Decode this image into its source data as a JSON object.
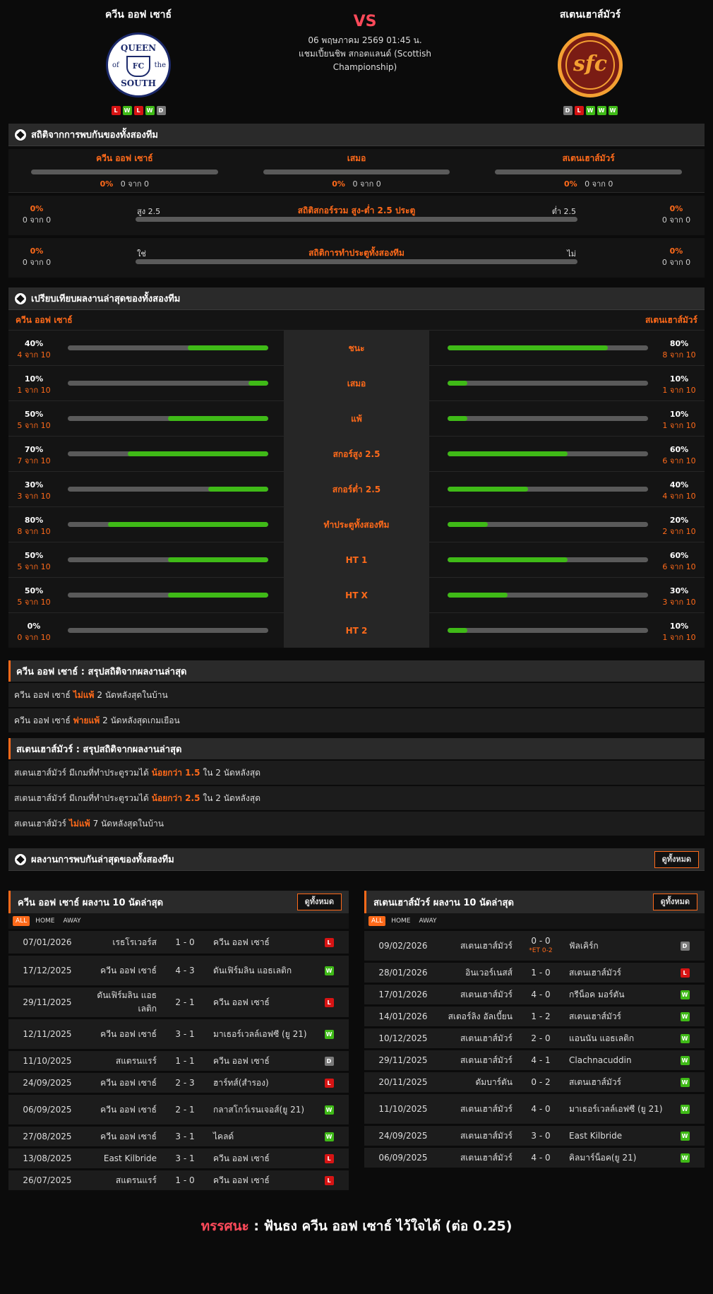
{
  "header": {
    "home_name": "ควีน ออฟ เซาธ์",
    "away_name": "สเตนเฮาส์มัวร์",
    "vs": "VS",
    "date": "06 พฤษภาคม 2569 01:45 น.",
    "competition": "แชมเปี้ยนชิพ สกอตแลนด์ (Scottish Championship)",
    "home_form": [
      "L",
      "W",
      "L",
      "W",
      "D"
    ],
    "away_form": [
      "D",
      "L",
      "W",
      "W",
      "W"
    ],
    "home_logo": {
      "top": "QUEEN",
      "bottom": "SOUTH",
      "of": "of",
      "the": "the",
      "mid": "FC"
    },
    "away_logo": {
      "text": "sfc"
    }
  },
  "h2h": {
    "title": "สถิติจากการพบกันของทั้งสองทีม",
    "home": {
      "label": "ควีน ออฟ เซาธ์",
      "pct": "0%",
      "count": "0 จาก 0"
    },
    "draw": {
      "label": "เสมอ",
      "pct": "0%",
      "count": "0 จาก 0"
    },
    "away": {
      "label": "สเตนเฮาส์มัวร์",
      "pct": "0%",
      "count": "0 จาก 0"
    },
    "ou": {
      "title": "สถิติสกอร์รวม สูง-ต่ำ 2.5 ประตู",
      "left_tag": "สูง 2.5",
      "right_tag": "ต่ำ 2.5",
      "l_pct": "0%",
      "l_cnt": "0 จาก 0",
      "r_pct": "0%",
      "r_cnt": "0 จาก 0"
    },
    "btts": {
      "title": "สถิติการทำประตูทั้งสองทีม",
      "left_tag": "ใช่",
      "right_tag": "ไม่",
      "l_pct": "0%",
      "l_cnt": "0 จาก 0",
      "r_pct": "0%",
      "r_cnt": "0 จาก 0"
    }
  },
  "compare": {
    "title": "เปรียบเทียบผลงานล่าสุดของทั้งสองทีม",
    "home_label": "ควีน ออฟ เซาธ์",
    "away_label": "สเตนเฮาส์มัวร์",
    "rows": [
      {
        "label": "ชนะ",
        "h_pct": "40%",
        "h_cnt": "4 จาก 10",
        "h_val": 0.4,
        "a_pct": "80%",
        "a_cnt": "8 จาก 10",
        "a_val": 0.8
      },
      {
        "label": "เสมอ",
        "h_pct": "10%",
        "h_cnt": "1 จาก 10",
        "h_val": 0.1,
        "a_pct": "10%",
        "a_cnt": "1 จาก 10",
        "a_val": 0.1
      },
      {
        "label": "แพ้",
        "h_pct": "50%",
        "h_cnt": "5 จาก 10",
        "h_val": 0.5,
        "a_pct": "10%",
        "a_cnt": "1 จาก 10",
        "a_val": 0.1
      },
      {
        "label": "สกอร์สูง 2.5",
        "h_pct": "70%",
        "h_cnt": "7 จาก 10",
        "h_val": 0.7,
        "a_pct": "60%",
        "a_cnt": "6 จาก 10",
        "a_val": 0.6
      },
      {
        "label": "สกอร์ต่ำ 2.5",
        "h_pct": "30%",
        "h_cnt": "3 จาก 10",
        "h_val": 0.3,
        "a_pct": "40%",
        "a_cnt": "4 จาก 10",
        "a_val": 0.4
      },
      {
        "label": "ทำประตูทั้งสองทีม",
        "h_pct": "80%",
        "h_cnt": "8 จาก 10",
        "h_val": 0.8,
        "a_pct": "20%",
        "a_cnt": "2 จาก 10",
        "a_val": 0.2
      },
      {
        "label": "HT 1",
        "h_pct": "50%",
        "h_cnt": "5 จาก 10",
        "h_val": 0.5,
        "a_pct": "60%",
        "a_cnt": "6 จาก 10",
        "a_val": 0.6
      },
      {
        "label": "HT X",
        "h_pct": "50%",
        "h_cnt": "5 จาก 10",
        "h_val": 0.5,
        "a_pct": "30%",
        "a_cnt": "3 จาก 10",
        "a_val": 0.3
      },
      {
        "label": "HT 2",
        "h_pct": "0%",
        "h_cnt": "0 จาก 10",
        "h_val": 0.0,
        "a_pct": "10%",
        "a_cnt": "1 จาก 10",
        "a_val": 0.1
      }
    ]
  },
  "home_summary": {
    "title": "ควีน ออฟ เซาธ์ : สรุปสถิติจากผลงานล่าสุด",
    "lines": [
      {
        "pre": "ควีน ออฟ เซาธ์",
        "hl": "ไม่แพ้",
        "post": "2  นัดหลังสุดในบ้าน"
      },
      {
        "pre": "ควีน ออฟ เซาธ์",
        "hl": "พ่ายแพ้",
        "post": "2  นัดหลังสุดเกมเยือน"
      }
    ]
  },
  "away_summary": {
    "title": "สเตนเฮาส์มัวร์ : สรุปสถิติจากผลงานล่าสุด",
    "lines": [
      {
        "pre": "สเตนเฮาส์มัวร์  มีเกมที่ทำประตูรวมได้",
        "hl": "น้อยกว่า  1.5",
        "post": "ใน 2 นัดหลังสุด"
      },
      {
        "pre": "สเตนเฮาส์มัวร์  มีเกมที่ทำประตูรวมได้",
        "hl": "น้อยกว่า  2.5",
        "post": "ใน 2 นัดหลังสุด"
      },
      {
        "pre": "สเตนเฮาส์มัวร์",
        "hl": "ไม่แพ้",
        "post": "7  นัดหลังสุดในบ้าน"
      }
    ]
  },
  "recent": {
    "title": "ผลงานการพบกันล่าสุดของทั้งสองทีม",
    "view_all": "ดูทั้งหมด"
  },
  "home_last10": {
    "title": "ควีน ออฟ เซาธ์ ผลงาน 10 นัดล่าสุด",
    "view_all": "ดูทั้งหมด",
    "tabs": [
      "ALL",
      "HOME",
      "AWAY"
    ],
    "matches": [
      {
        "date": "07/01/2026",
        "home": "เรธโรเวอร์ส",
        "score": "1 - 0",
        "away": "ควีน ออฟ เซาธ์",
        "res": "L",
        "h": 32
      },
      {
        "date": "17/12/2025",
        "home": "ควีน ออฟ เซาธ์",
        "score": "4 - 3",
        "away": "ดันเฟิร์มลิน แอธเลติก",
        "res": "W",
        "h": 42
      },
      {
        "date": "29/11/2025",
        "home": "ดันเฟิร์มลิน แอธเลติก",
        "score": "2 - 1",
        "away": "ควีน ออฟ เซาธ์",
        "res": "L",
        "h": 42
      },
      {
        "date": "12/11/2025",
        "home": "ควีน ออฟ เซาธ์",
        "score": "3 - 1",
        "away": "มาเธอร์เวลล์เอฟซี (ยู 21)",
        "res": "W",
        "h": 42
      },
      {
        "date": "11/10/2025",
        "home": "สแตรนแรร์",
        "score": "1 - 1",
        "away": "ควีน ออฟ เซาธ์",
        "res": "D",
        "h": 28
      },
      {
        "date": "24/09/2025",
        "home": "ควีน ออฟ เซาธ์",
        "score": "2 - 3",
        "away": "ฮาร์ทส์(สำรอง)",
        "res": "L",
        "h": 28
      },
      {
        "date": "06/09/2025",
        "home": "ควีน ออฟ เซาธ์",
        "score": "2 - 1",
        "away": "กลาสโกว์เรนเจอส์(ยู 21)",
        "res": "W",
        "h": 42
      },
      {
        "date": "27/08/2025",
        "home": "ควีน ออฟ เซาธ์",
        "score": "3 - 1",
        "away": "ไคลด์",
        "res": "W",
        "h": 28
      },
      {
        "date": "13/08/2025",
        "home": "East Kilbride",
        "score": "3 - 1",
        "away": "ควีน ออฟ เซาธ์",
        "res": "L",
        "h": 28
      },
      {
        "date": "26/07/2025",
        "home": "สแตรนแรร์",
        "score": "1 - 0",
        "away": "ควีน ออฟ เซาธ์",
        "res": "L",
        "h": 28
      }
    ]
  },
  "away_last10": {
    "title": "สเตนเฮาส์มัวร์ ผลงาน 10 นัดล่าสุด",
    "view_all": "ดูทั้งหมด",
    "tabs": [
      "ALL",
      "HOME",
      "AWAY"
    ],
    "matches": [
      {
        "date": "09/02/2026",
        "home": "สเตนเฮาส์มัวร์",
        "score": "0 - 0",
        "et": "*ET 0-2",
        "away": "ฟัลเคิร์ก",
        "res": "D",
        "h": 42
      },
      {
        "date": "28/01/2026",
        "home": "อินเวอร์เนสส์",
        "score": "1 - 0",
        "away": "สเตนเฮาส์มัวร์",
        "res": "L",
        "h": 28
      },
      {
        "date": "17/01/2026",
        "home": "สเตนเฮาส์มัวร์",
        "score": "4 - 0",
        "away": "กรีน็อค มอร์ตัน",
        "res": "W",
        "h": 28
      },
      {
        "date": "14/01/2026",
        "home": "สเตอร์ลิง อัลเบี้ยน",
        "score": "1 - 2",
        "away": "สเตนเฮาส์มัวร์",
        "res": "W",
        "h": 28
      },
      {
        "date": "10/12/2025",
        "home": "สเตนเฮาส์มัวร์",
        "score": "2 - 0",
        "away": "แอนนัน แอธเลติก",
        "res": "W",
        "h": 28
      },
      {
        "date": "29/11/2025",
        "home": "สเตนเฮาส์มัวร์",
        "score": "4 - 1",
        "away": "Clachnacuddin",
        "res": "W",
        "h": 28
      },
      {
        "date": "20/11/2025",
        "home": "ดัมบาร์ตัน",
        "score": "0 - 2",
        "away": "สเตนเฮาส์มัวร์",
        "res": "W",
        "h": 28
      },
      {
        "date": "11/10/2025",
        "home": "สเตนเฮาส์มัวร์",
        "score": "4 - 0",
        "away": "มาเธอร์เวลล์เอฟซี (ยู 21)",
        "res": "W",
        "h": 42
      },
      {
        "date": "24/09/2025",
        "home": "สเตนเฮาส์มัวร์",
        "score": "3 - 0",
        "away": "East Kilbride",
        "res": "W",
        "h": 28
      },
      {
        "date": "06/09/2025",
        "home": "สเตนเฮาส์มัวร์",
        "score": "4 - 0",
        "away": "คิลมาร์น็อค(ยู 21)",
        "res": "W",
        "h": 28
      }
    ]
  },
  "verdict": {
    "label": "ทรรศนะ",
    "sep": " : ",
    "text": "ฟันธง ควีน ออฟ เซาธ์ ไว้ใจได้ (ต่อ 0.25)"
  },
  "colors": {
    "accent": "#ff6a1a",
    "win": "#3fba17",
    "loss": "#d71414",
    "draw": "#7a7a7a",
    "vs": "#ff4a5a"
  }
}
